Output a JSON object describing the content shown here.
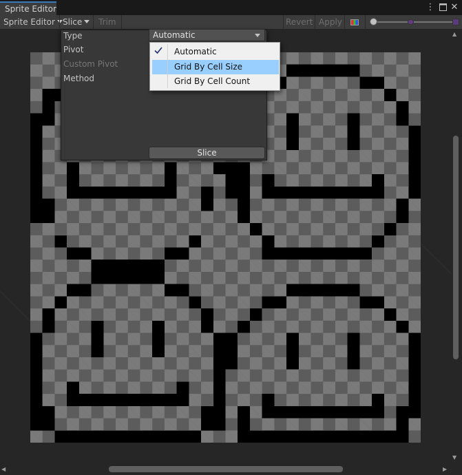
{
  "window": {
    "tab_title": "Sprite Editor",
    "menu_icon": "kebab-menu-icon",
    "maximize_icon": "maximize-icon",
    "close_icon": "close-icon"
  },
  "toolbar": {
    "mode_label": "Sprite Editor",
    "slice_label": "Slice",
    "trim_label": "Trim",
    "revert_label": "Revert",
    "apply_label": "Apply",
    "channel_icon": "rgb-channel-icon"
  },
  "slice_panel": {
    "type_label": "Type",
    "type_value": "Automatic",
    "pivot_label": "Pivot",
    "custom_pivot_label": "Custom Pivot",
    "method_label": "Method",
    "slice_button": "Slice"
  },
  "type_menu": {
    "selected": "Automatic",
    "highlighted": "Grid By Cell Size",
    "options": [
      "Automatic",
      "Grid By Cell Size",
      "Grid By Cell Count"
    ]
  },
  "colors": {
    "accent": "#3a79bb",
    "menu_highlight": "#99cfff",
    "sprite_outline": "#000000",
    "checker_light": "#7a7a7a",
    "checker_dark": "#5c5c5c"
  }
}
